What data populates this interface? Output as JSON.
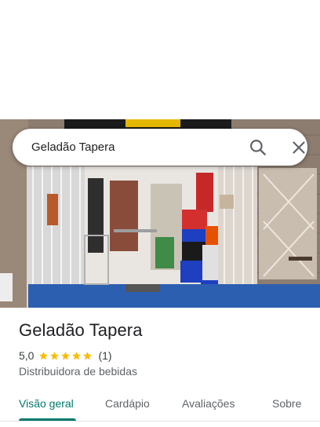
{
  "search": {
    "query": "Geladão Tapera",
    "search_icon": "search-icon",
    "close_icon": "close-icon"
  },
  "photo": {
    "subject": "storefront-photo"
  },
  "place": {
    "name": "Geladão Tapera",
    "rating": "5,0",
    "stars": 5,
    "review_count": "(1)",
    "category": "Distribuidora de bebidas"
  },
  "tabs": [
    {
      "label": "Visão geral",
      "active": true
    },
    {
      "label": "Cardápio",
      "active": false
    },
    {
      "label": "Avaliações",
      "active": false
    },
    {
      "label": "Sobre",
      "active": false
    }
  ],
  "colors": {
    "accent": "#00796b",
    "star": "#fbbc04",
    "text_primary": "#202124",
    "text_secondary": "#5f6368"
  }
}
